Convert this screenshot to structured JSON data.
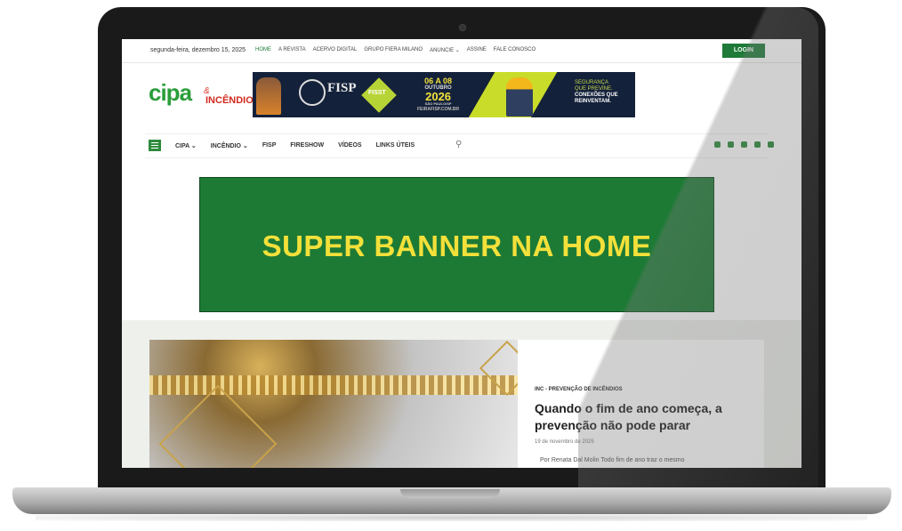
{
  "topbar": {
    "date": "segunda-feira, dezembro 15, 2025",
    "nav": [
      "HOME",
      "A REVISTA",
      "ACERVO DIGITAL",
      "GRUPO FIERA MILANO",
      "ANUNCIE ⌄",
      "ASSINE",
      "FALE CONOSCO"
    ],
    "login_label": "LOGIN"
  },
  "logo": {
    "word": "cipa",
    "amp": "&",
    "sub": "INCÊNDIO"
  },
  "header_banner": {
    "fisp": "FISP",
    "fisst": "FISST",
    "dates": "06 A 08",
    "month": "OUTUBRO",
    "year": "2026",
    "city": "SÃO PAULO/SP",
    "site": "FEIRAFISP.COM.BR",
    "tagline1": "SEGURANÇA",
    "tagline2": "QUE PREVINE.",
    "tagline3": "CONEXÕES QUE",
    "tagline4": "REINVENTAM."
  },
  "mainnav": {
    "items": [
      "CIPA ⌄",
      "INCÊNDIO ⌄",
      "FISP",
      "FIRESHOW",
      "VÍDEOS",
      "LINKS ÚTEIS"
    ],
    "social": [
      "facebook-icon",
      "instagram-icon",
      "linkedin-icon",
      "youtube-icon",
      "other-icon"
    ]
  },
  "super_banner": {
    "text": "SUPER BANNER NA HOME"
  },
  "article": {
    "category": "INC - PREVENÇÃO DE INCÊNDIOS",
    "headline": "Quando o fim de ano começa, a prevenção não pode parar",
    "date": "19 de novembro de 2025",
    "excerpt": "Por Renata Dal Molin   Todo fim de ano traz o mesmo"
  },
  "colors": {
    "brand_green": "#1d7a35",
    "banner_text": "#f3e03a",
    "logo_red": "#d22a1e"
  }
}
